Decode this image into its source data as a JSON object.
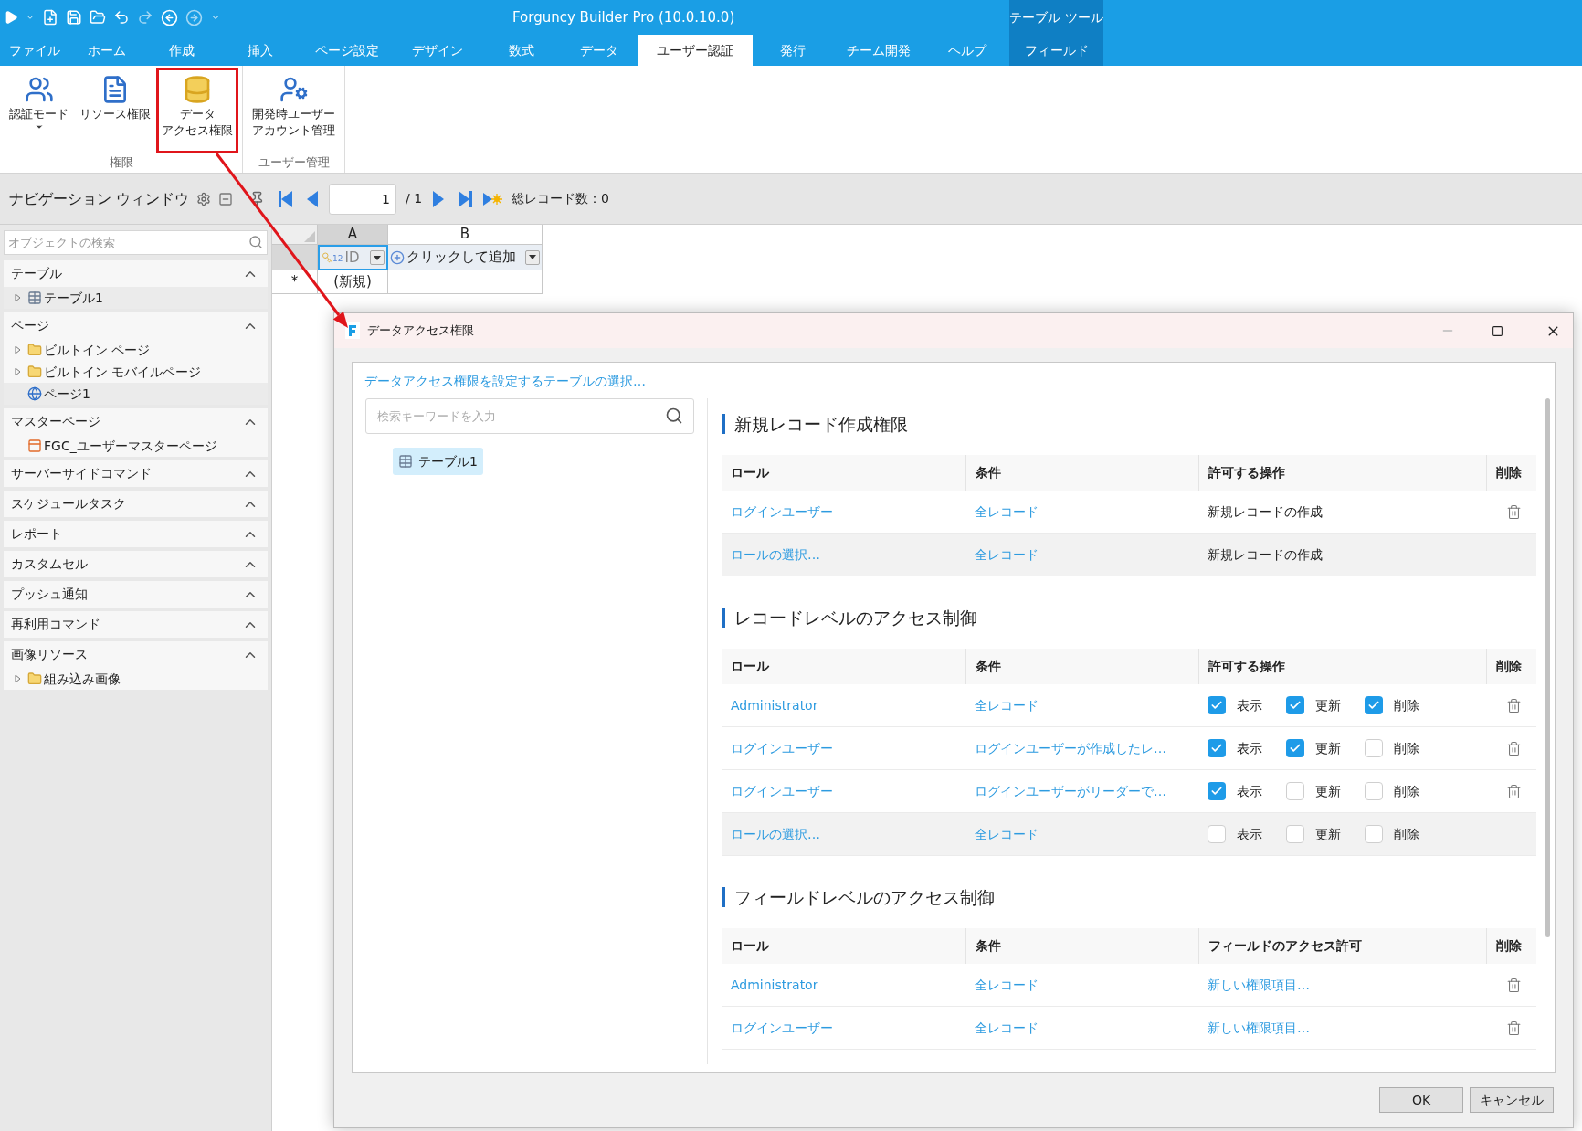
{
  "window": {
    "title": "Forguncy Builder Pro (10.0.10.0)",
    "context_tab_group": "テーブル ツール"
  },
  "menu_tabs": [
    {
      "label": "ファイル",
      "selected": false,
      "contextual": false
    },
    {
      "label": "ホーム",
      "selected": false,
      "contextual": false
    },
    {
      "label": "作成",
      "selected": false,
      "contextual": false
    },
    {
      "label": "挿入",
      "selected": false,
      "contextual": false
    },
    {
      "label": "ページ設定",
      "selected": false,
      "contextual": false
    },
    {
      "label": "デザイン",
      "selected": false,
      "contextual": false
    },
    {
      "label": "数式",
      "selected": false,
      "contextual": false
    },
    {
      "label": "データ",
      "selected": false,
      "contextual": false
    },
    {
      "label": "ユーザー認証",
      "selected": true,
      "contextual": false
    },
    {
      "label": "発行",
      "selected": false,
      "contextual": false
    },
    {
      "label": "チーム開発",
      "selected": false,
      "contextual": false
    },
    {
      "label": "ヘルプ",
      "selected": false,
      "contextual": false
    },
    {
      "label": "フィールド",
      "selected": false,
      "contextual": true
    }
  ],
  "ribbon": {
    "groups": [
      {
        "label": "権限",
        "buttons": [
          {
            "label": "認証モード",
            "kind": "auth",
            "dropdown": true,
            "highlighted": false
          },
          {
            "label": "リソース権限",
            "kind": "resource",
            "dropdown": false,
            "highlighted": false
          },
          {
            "label": [
              "データ",
              "アクセス権限"
            ],
            "kind": "data",
            "dropdown": false,
            "highlighted": true
          }
        ]
      },
      {
        "label": "ユーザー管理",
        "buttons": [
          {
            "label": [
              "開発時ユーザー",
              "アカウント管理"
            ],
            "kind": "users",
            "dropdown": false,
            "highlighted": false
          }
        ]
      }
    ]
  },
  "navigation_pane": {
    "title": "ナビゲーション ウィンドウ",
    "search": {
      "placeholder": "オブジェクトの検索"
    },
    "sections": [
      {
        "label": "テーブル",
        "expanded": true,
        "items": [
          {
            "label": "テーブル1",
            "kind": "table",
            "expandable": true,
            "selected": true
          }
        ]
      },
      {
        "label": "ページ",
        "expanded": true,
        "items": [
          {
            "label": "ビルトイン ページ",
            "kind": "folder",
            "expandable": true,
            "selected": false
          },
          {
            "label": "ビルトイン モバイルページ",
            "kind": "folder",
            "expandable": true,
            "selected": false
          },
          {
            "label": "ページ1",
            "kind": "page",
            "expandable": false,
            "selected": true
          }
        ]
      },
      {
        "label": "マスターページ",
        "expanded": true,
        "items": [
          {
            "label": "FGC_ユーザーマスターページ",
            "kind": "master",
            "expandable": false,
            "selected": false
          }
        ]
      },
      {
        "label": "サーバーサイドコマンド",
        "expanded": true
      },
      {
        "label": "スケジュールタスク",
        "expanded": true
      },
      {
        "label": "レポート",
        "expanded": true
      },
      {
        "label": "カスタムセル",
        "expanded": true
      },
      {
        "label": "プッシュ通知",
        "expanded": true
      },
      {
        "label": "再利用コマンド",
        "expanded": true
      },
      {
        "label": "画像リソース",
        "expanded": true,
        "items": [
          {
            "label": "組み込み画像",
            "kind": "folder",
            "expandable": true,
            "selected": false
          }
        ]
      }
    ]
  },
  "record_navigator": {
    "page": "1",
    "total_pages": "/ 1",
    "record_count": "総レコード数：0"
  },
  "grid": {
    "columns": [
      {
        "letter": "A",
        "selected": true
      },
      {
        "letter": "B",
        "selected": false
      }
    ],
    "fields": [
      {
        "label": "ID",
        "kind": "key",
        "key_badge": "12"
      },
      {
        "label": "クリックして追加",
        "kind": "add"
      }
    ],
    "new_row": {
      "marker": "*",
      "label": "(新規)"
    }
  },
  "dialog": {
    "title": "データアクセス権限",
    "table_picker": {
      "prompt": "データアクセス権限を設定するテーブルの選択…",
      "search": {
        "placeholder": "検索キーワードを入力"
      },
      "tables": [
        {
          "label": "テーブル1",
          "selected": true
        }
      ]
    },
    "sections": [
      {
        "kind": "create",
        "title": "新規レコード作成権限",
        "columns": [
          "ロール",
          "条件",
          "許可する操作",
          "削除"
        ],
        "rows": [
          {
            "role": "ログインユーザー",
            "condition": "全レコード",
            "operation": "新規レコードの作成",
            "placeholder": false
          },
          {
            "role": "ロールの選択…",
            "condition": "全レコード",
            "operation": "新規レコードの作成",
            "placeholder": true
          }
        ]
      },
      {
        "kind": "record",
        "title": "レコードレベルのアクセス制御",
        "columns": [
          "ロール",
          "条件",
          "許可する操作",
          "削除"
        ],
        "rows": [
          {
            "role": "Administrator",
            "condition": "全レコード",
            "placeholder": false,
            "operations": [
              {
                "label": "表示",
                "checked": true
              },
              {
                "label": "更新",
                "checked": true
              },
              {
                "label": "削除",
                "checked": true
              }
            ]
          },
          {
            "role": "ログインユーザー",
            "condition": "ログインユーザーが作成したレ…",
            "placeholder": false,
            "operations": [
              {
                "label": "表示",
                "checked": true
              },
              {
                "label": "更新",
                "checked": true
              },
              {
                "label": "削除",
                "checked": false
              }
            ]
          },
          {
            "role": "ログインユーザー",
            "condition": "ログインユーザーがリーダーで…",
            "placeholder": false,
            "operations": [
              {
                "label": "表示",
                "checked": true
              },
              {
                "label": "更新",
                "checked": false
              },
              {
                "label": "削除",
                "checked": false
              }
            ]
          },
          {
            "role": "ロールの選択…",
            "condition": "全レコード",
            "placeholder": true,
            "operations": [
              {
                "label": "表示",
                "checked": false
              },
              {
                "label": "更新",
                "checked": false
              },
              {
                "label": "削除",
                "checked": false
              }
            ]
          }
        ]
      },
      {
        "kind": "field",
        "title": "フィールドレベルのアクセス制御",
        "columns": [
          "ロール",
          "条件",
          "フィールドのアクセス許可",
          "削除"
        ],
        "rows": [
          {
            "role": "Administrator",
            "condition": "全レコード",
            "access": "新しい権限項目…",
            "placeholder": false
          },
          {
            "role": "ログインユーザー",
            "condition": "全レコード",
            "access": "新しい権限項目…",
            "placeholder": false
          }
        ]
      }
    ],
    "buttons": [
      {
        "label": "OK"
      },
      {
        "label": "キャンセル"
      }
    ]
  }
}
